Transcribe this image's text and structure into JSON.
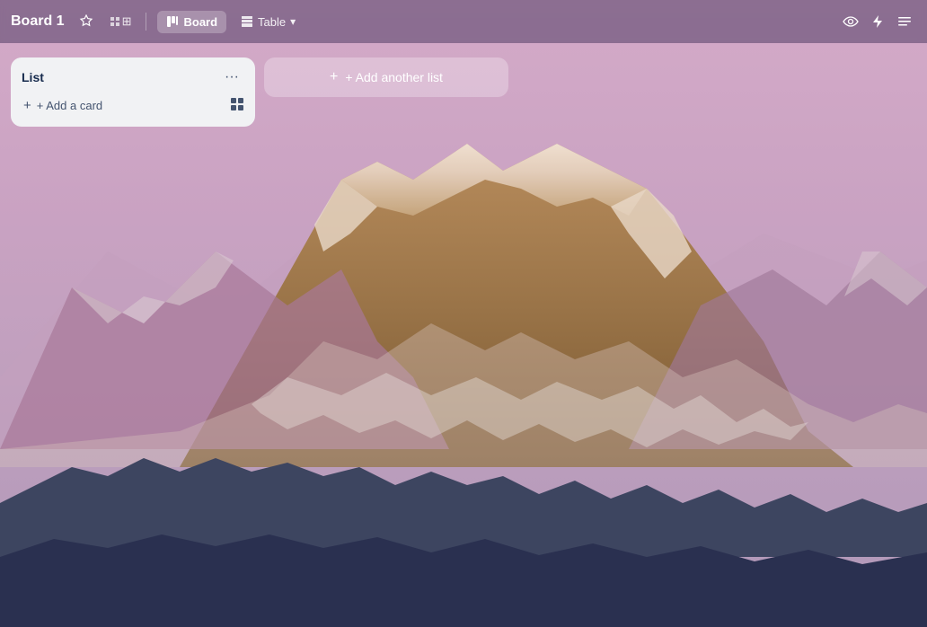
{
  "header": {
    "board_title": "Board 1",
    "view_board_label": "Board",
    "view_table_label": "Table",
    "chevron_down": "▾",
    "star_icon": "☆",
    "filter_icon": "⊞",
    "watch_icon": "◎",
    "lightning_icon": "⚡",
    "menu_icon": "☰"
  },
  "list": {
    "title": "List",
    "menu_dots": "•••",
    "add_card_label": "+ Add a card",
    "card_template_icon": "▣"
  },
  "add_list": {
    "label": "+ Add another list"
  }
}
